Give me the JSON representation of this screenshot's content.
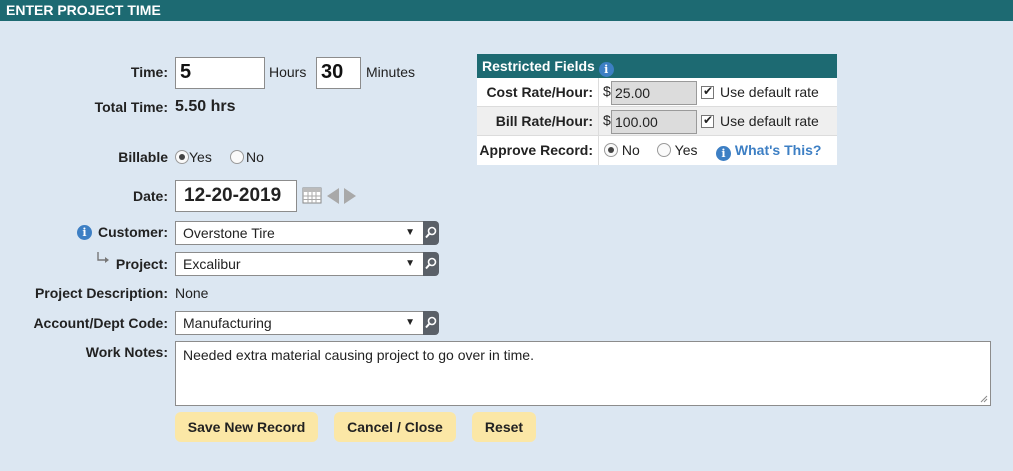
{
  "title": "ENTER PROJECT TIME",
  "time": {
    "label": "Time:",
    "hours_value": "5",
    "hours_unit": "Hours",
    "minutes_value": "30",
    "minutes_unit": "Minutes"
  },
  "total_time": {
    "label": "Total Time:",
    "value": "5.50 hrs"
  },
  "billable": {
    "label": "Billable",
    "yes": "Yes",
    "no": "No",
    "selected": "Yes"
  },
  "date": {
    "label": "Date:",
    "value": "12-20-2019"
  },
  "customer": {
    "label": "Customer:",
    "value": "Overstone Tire"
  },
  "project": {
    "label": "Project:",
    "value": "Excalibur"
  },
  "project_description": {
    "label": "Project Description:",
    "value": "None"
  },
  "account": {
    "label": "Account/Dept Code:",
    "value": "Manufacturing"
  },
  "work_notes": {
    "label": "Work Notes:",
    "value": "Needed extra material causing project to go over in time."
  },
  "buttons": {
    "save": "Save New Record",
    "cancel": "Cancel / Close",
    "reset": "Reset"
  },
  "restricted": {
    "title": "Restricted Fields",
    "cost_rate": {
      "label": "Cost Rate/Hour:",
      "currency": "$",
      "value": "25.00",
      "default_label": "Use default rate",
      "default_checked": true
    },
    "bill_rate": {
      "label": "Bill Rate/Hour:",
      "currency": "$",
      "value": "100.00",
      "default_label": "Use default rate",
      "default_checked": true
    },
    "approve": {
      "label": "Approve Record:",
      "no": "No",
      "yes": "Yes",
      "selected": "No",
      "help_link": "What's This?"
    }
  },
  "colors": {
    "header": "#1d6a72",
    "background": "#dce7f2",
    "button": "#fbe7a6",
    "link": "#3d7fc4"
  },
  "icons": [
    "info-icon",
    "calendar-icon",
    "arrow-left-icon",
    "arrow-right-icon",
    "magnifier-icon",
    "subitem-arrow-icon",
    "dropdown-caret-icon"
  ]
}
